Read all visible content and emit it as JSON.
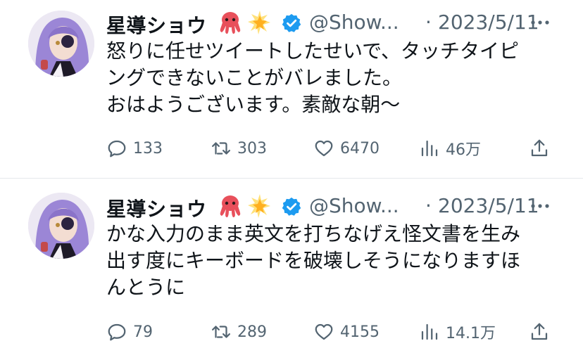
{
  "tweets": [
    {
      "name": "星導ショウ",
      "handle": "@Show...",
      "separator": "·",
      "date": "2023/5/11",
      "text": "怒りに任せツイートしたせいで、タッチタイピ\nングできないことがバレました。\nおはようございます。素敵な朝〜",
      "replies": "133",
      "retweets": "303",
      "likes": "6470",
      "views": "46万"
    },
    {
      "name": "星導ショウ",
      "handle": "@Show...",
      "separator": "·",
      "date": "2023/5/11",
      "text": "かな入力のまま英文を打ちなげえ怪文書を生み\n出す度にキーボードを破壊しそうになりますほ\nんとうに",
      "replies": "79",
      "retweets": "289",
      "likes": "4155",
      "views": "14.1万"
    }
  ],
  "colors": {
    "text": "#0f1419",
    "secondary": "#536471",
    "verified": "#1d9bf0",
    "avatar_hair": "#9b86d6"
  },
  "icons": [
    "octopus-emoji",
    "glowing-star-emoji",
    "verified-badge-icon",
    "more-icon",
    "reply-icon",
    "retweet-icon",
    "like-icon",
    "views-icon",
    "share-icon"
  ]
}
